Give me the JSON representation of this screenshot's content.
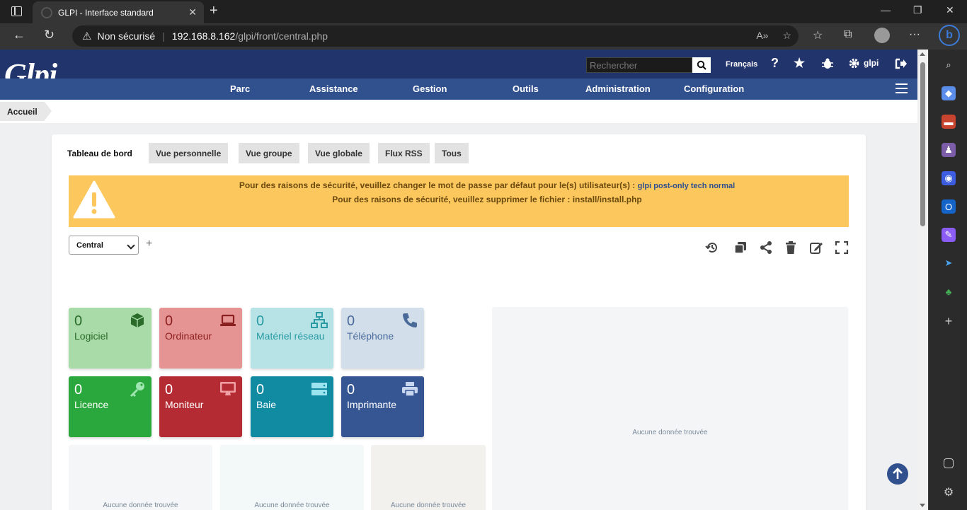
{
  "browser": {
    "tab_title": "GLPI - Interface standard",
    "security_label": "Non sécurisé",
    "url_host": "192.168.8.162",
    "url_path": "/glpi/front/central.php"
  },
  "header": {
    "logo_text": "Glpi",
    "search_placeholder": "Rechercher",
    "language": "Français",
    "username": "glpi",
    "help_label": "?"
  },
  "menu": {
    "items": [
      "Parc",
      "Assistance",
      "Gestion",
      "Outils",
      "Administration",
      "Configuration"
    ]
  },
  "breadcrumb": {
    "home": "Accueil"
  },
  "dashboard": {
    "tabs": [
      "Tableau de bord",
      "Vue personnelle",
      "Vue groupe",
      "Vue globale",
      "Flux RSS",
      "Tous"
    ],
    "alert": {
      "line1": "Pour des raisons de sécurité, veuillez changer le mot de passe par défaut pour le(s) utilisateur(s) :",
      "line1_users": "glpi post-only tech normal",
      "line2": "Pour des raisons de sécurité, veuillez supprimer le fichier : install/install.php"
    },
    "selected_dashboard": "Central",
    "tiles": [
      {
        "value": "0",
        "label": "Logiciel",
        "icon": "box-icon",
        "bg": "#a8dba8",
        "fg": "#2a6b2a"
      },
      {
        "value": "0",
        "label": "Ordinateur",
        "icon": "laptop-icon",
        "bg": "#e69393",
        "fg": "#8a1f1f"
      },
      {
        "value": "0",
        "label": "Matériel réseau",
        "icon": "network-icon",
        "bg": "#b7e3e6",
        "fg": "#2a9aa3"
      },
      {
        "value": "0",
        "label": "Téléphone",
        "icon": "phone-icon",
        "bg": "#d2dfeb",
        "fg": "#4a6a9a"
      },
      {
        "value": "0",
        "label": "Licence",
        "icon": "key-icon",
        "bg": "#2aa83d",
        "fg": "#ffffff"
      },
      {
        "value": "0",
        "label": "Moniteur",
        "icon": "monitor-icon",
        "bg": "#b52b33",
        "fg": "#ffffff"
      },
      {
        "value": "0",
        "label": "Baie",
        "icon": "server-icon",
        "bg": "#118ba1",
        "fg": "#ffffff"
      },
      {
        "value": "0",
        "label": "Imprimante",
        "icon": "printer-icon",
        "bg": "#365593",
        "fg": "#ffffff"
      }
    ],
    "empty_text": "Aucune donnée trouvée"
  }
}
